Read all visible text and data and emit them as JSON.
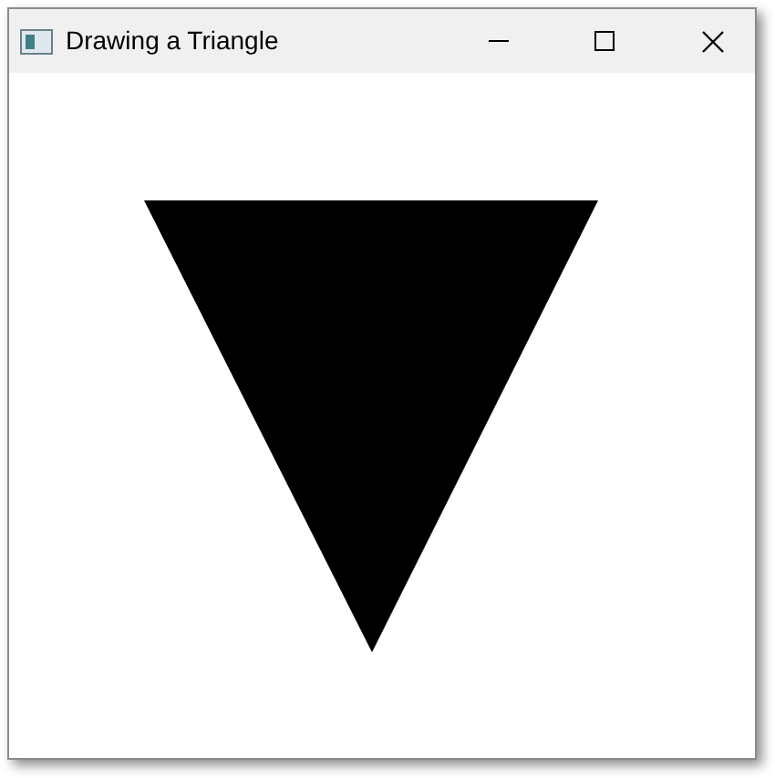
{
  "window": {
    "title": "Drawing a Triangle"
  }
}
